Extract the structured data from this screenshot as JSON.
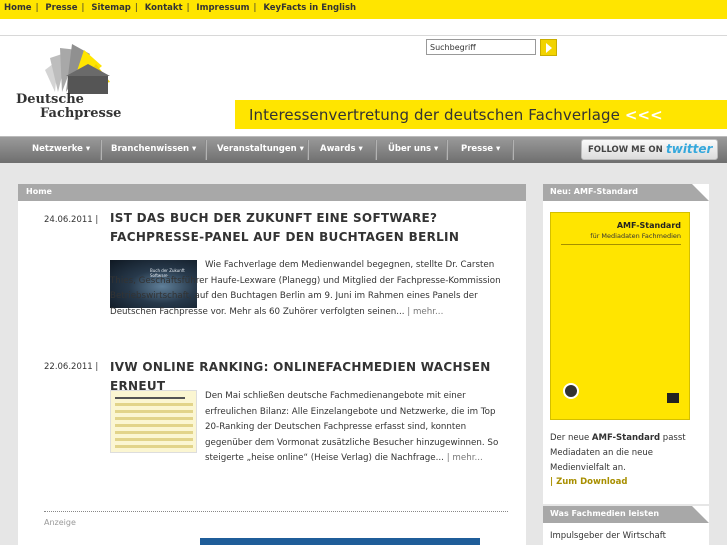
{
  "top_nav": {
    "items": [
      "Home",
      "Presse",
      "Sitemap",
      "Kontakt",
      "Impressum",
      "KeyFacts in English"
    ]
  },
  "logo": {
    "line1": "Deutsche",
    "line2": "Fachpresse"
  },
  "search": {
    "value": "Suchbegriff"
  },
  "slogan": {
    "text": "Interessenvertretung der deutschen Fachverlage",
    "arrows": "<<<"
  },
  "main_nav": {
    "items": [
      "Netzwerke",
      "Branchenwissen",
      "Veranstaltungen",
      "Awards",
      "Über uns",
      "Presse"
    ]
  },
  "follow": {
    "label": "FOLLOW ME ON",
    "brand": "twitter"
  },
  "breadcrumb": {
    "label": "Home"
  },
  "articles": [
    {
      "date": "24.06.2011 |",
      "title": "IST DAS BUCH DER ZUKUNFT EINE SOFTWARE? FACHPRESSE-PANEL AUF DEN BUCHTAGEN BERLIN",
      "text": "Wie Fachverlage dem Medienwandel begegnen, stellte Dr. Carsten Thies, Geschäftsführer Haufe-Lexware (Planegg) und Mitglied der Fachpresse-Kommission Betriebswirtschaft, auf den Buchtagen Berlin am 9. Juni im Rahmen eines Panels der Deutschen Fachpresse vor. Mehr als 60 Zuhörer verfolgten seinen...",
      "more": "| mehr...",
      "thumb_text": "Buch der Zukunft Software"
    },
    {
      "date": "22.06.2011 |",
      "title": "IVW ONLINE RANKING: ONLINEFACHMEDIEN WACHSEN ERNEUT",
      "text": "Den Mai schließen deutsche Fachmedienangebote mit einer erfreulichen Bilanz: Alle Einzelangebote und Netzwerke, die im Top 20-Ranking der Deutschen Fachpresse erfasst sind, konnten gegenüber dem Vormonat zusätzliche Besucher hinzugewinnen. So steigerte „heise online“ (Heise Verlag) die Nachfrage...",
      "more": "| mehr..."
    }
  ],
  "anzeige": "Anzeige",
  "sidebar": {
    "box1_title": "Neu: AMF-Standard",
    "cover_title": "AMF-Standard",
    "cover_subtitle": "für Mediadaten Fachmedien",
    "text_line1": "Der neue ",
    "text_bold": "AMF-Standard",
    "text_line1b": " passt",
    "text_line2": "Mediadaten an die neue",
    "text_line3": "Medienvielfalt an.",
    "download": "| Zum Download",
    "box2_title": "Was Fachmedien leisten",
    "box2_text": "Impulsgeber der Wirtschaft"
  },
  "colors": {
    "brand_yellow": "#ffe500",
    "nav_gray": "#7d7d7d",
    "link_gold": "#a88f00"
  }
}
